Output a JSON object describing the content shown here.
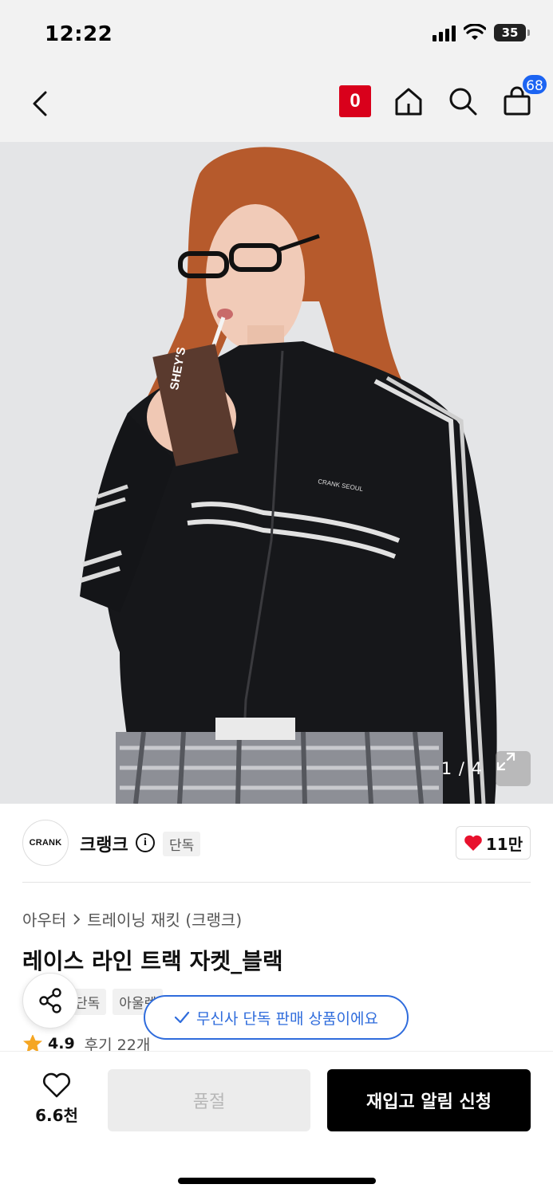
{
  "status_bar": {
    "time": "12:22",
    "battery": "35"
  },
  "header": {
    "brand_badge": "0",
    "cart_count": "68"
  },
  "gallery": {
    "counter": "1 / 4",
    "jacket_print": "CRANK SEOUL",
    "carton_print": "SHEY'S"
  },
  "brand": {
    "logo_text": "CRANK",
    "name": "크랭크",
    "info_glyph": "i",
    "exclusive_tag": "단독",
    "like_count": "11만"
  },
  "breadcrumb": {
    "category": "아우터",
    "separator": ">",
    "subcategory": "트레이닝 재킷 (크랭크)"
  },
  "product": {
    "title": "레이스 라인 트랙 자켓_블랙"
  },
  "tags": [
    "단독",
    "아울렛"
  ],
  "toast": {
    "message": "무신사 단독 판매 상품이에요"
  },
  "rating": {
    "score": "4.9",
    "reviews": "후기 22개"
  },
  "bottom_bar": {
    "wish_count": "6.6천",
    "soldout_label": "품절",
    "restock_label": "재입고 알림 신청"
  },
  "colors": {
    "accent_blue": "#2f6cdc",
    "brand_red": "#d9001b",
    "heart_red": "#e8112d",
    "star": "#f5a623"
  },
  "icons": [
    "back-icon",
    "home-icon",
    "search-icon",
    "cart-icon",
    "expand-icon",
    "info-icon",
    "heart-icon",
    "share-icon",
    "check-icon",
    "star-icon",
    "chevron-right-icon"
  ]
}
